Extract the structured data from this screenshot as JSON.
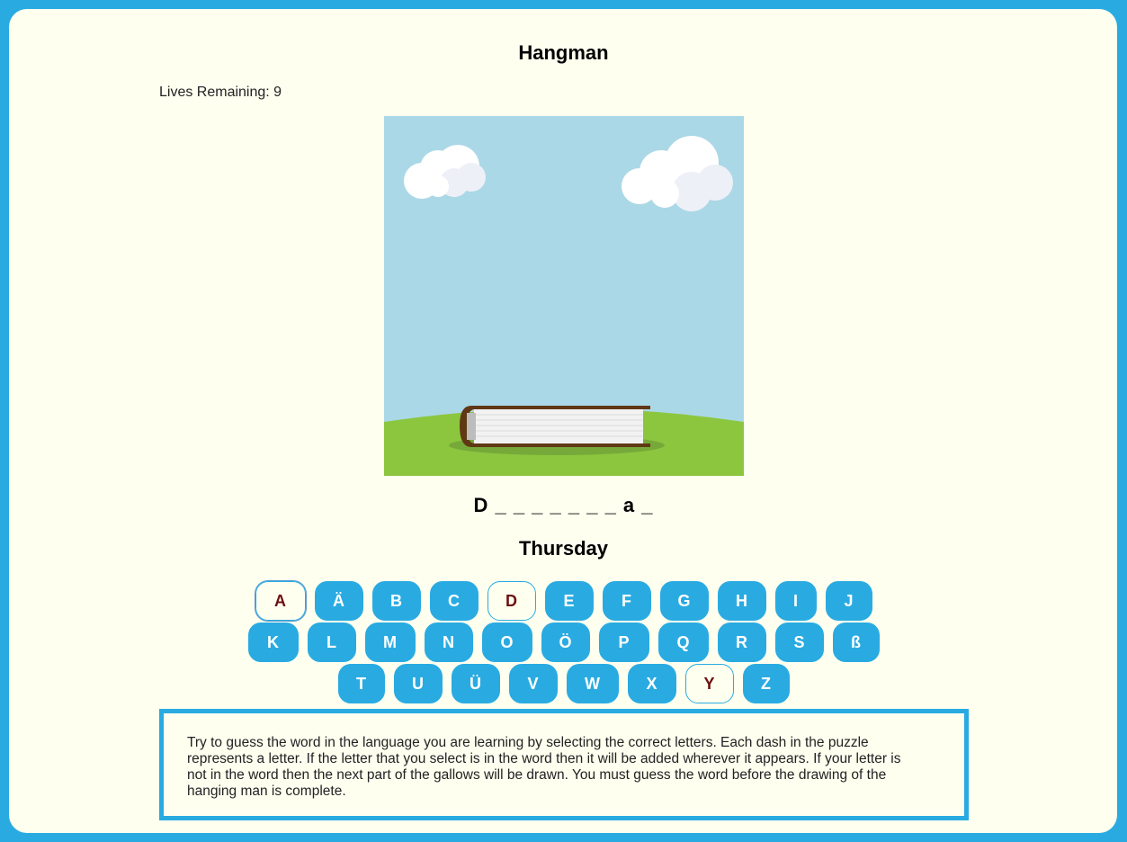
{
  "game": {
    "title": "Hangman",
    "lives_label": "Lives Remaining: 9",
    "puzzle": "D _ _ _ _ _ _ _ a _",
    "hint": "Thursday"
  },
  "keyboard": {
    "rows": [
      [
        {
          "letter": "A",
          "state": "used"
        },
        {
          "letter": "Ä",
          "state": "available"
        },
        {
          "letter": "B",
          "state": "available"
        },
        {
          "letter": "C",
          "state": "available"
        },
        {
          "letter": "D",
          "state": "used"
        },
        {
          "letter": "E",
          "state": "available"
        },
        {
          "letter": "F",
          "state": "available"
        },
        {
          "letter": "G",
          "state": "available"
        },
        {
          "letter": "H",
          "state": "available"
        },
        {
          "letter": "I",
          "state": "available"
        },
        {
          "letter": "J",
          "state": "available"
        }
      ],
      [
        {
          "letter": "K",
          "state": "available"
        },
        {
          "letter": "L",
          "state": "available"
        },
        {
          "letter": "M",
          "state": "available"
        },
        {
          "letter": "N",
          "state": "available"
        },
        {
          "letter": "O",
          "state": "available"
        },
        {
          "letter": "Ö",
          "state": "available"
        },
        {
          "letter": "P",
          "state": "available"
        },
        {
          "letter": "Q",
          "state": "available"
        },
        {
          "letter": "R",
          "state": "available"
        },
        {
          "letter": "S",
          "state": "available"
        },
        {
          "letter": "ß",
          "state": "available"
        }
      ],
      [
        {
          "letter": "T",
          "state": "available"
        },
        {
          "letter": "U",
          "state": "available"
        },
        {
          "letter": "Ü",
          "state": "available"
        },
        {
          "letter": "V",
          "state": "available"
        },
        {
          "letter": "W",
          "state": "available"
        },
        {
          "letter": "X",
          "state": "available"
        },
        {
          "letter": "Y",
          "state": "used"
        },
        {
          "letter": "Z",
          "state": "available"
        }
      ]
    ]
  },
  "instructions": {
    "text": "Try to guess the word in the language you are learning by selecting the correct letters. Each dash in the puzzle represents a letter. If the letter that you select is in the word then it will be added wherever it appears. If your letter is not in the word then the next part of the gallows will be drawn. You must guess the word before the drawing of the hanging man is complete."
  },
  "colors": {
    "frame": "#29abe2",
    "panel": "#fffff0",
    "key": "#29abe2",
    "used_key_text": "#6b1010",
    "sky": "#abd8e6",
    "grass": "#8cc63f",
    "book_cover": "#603813"
  }
}
